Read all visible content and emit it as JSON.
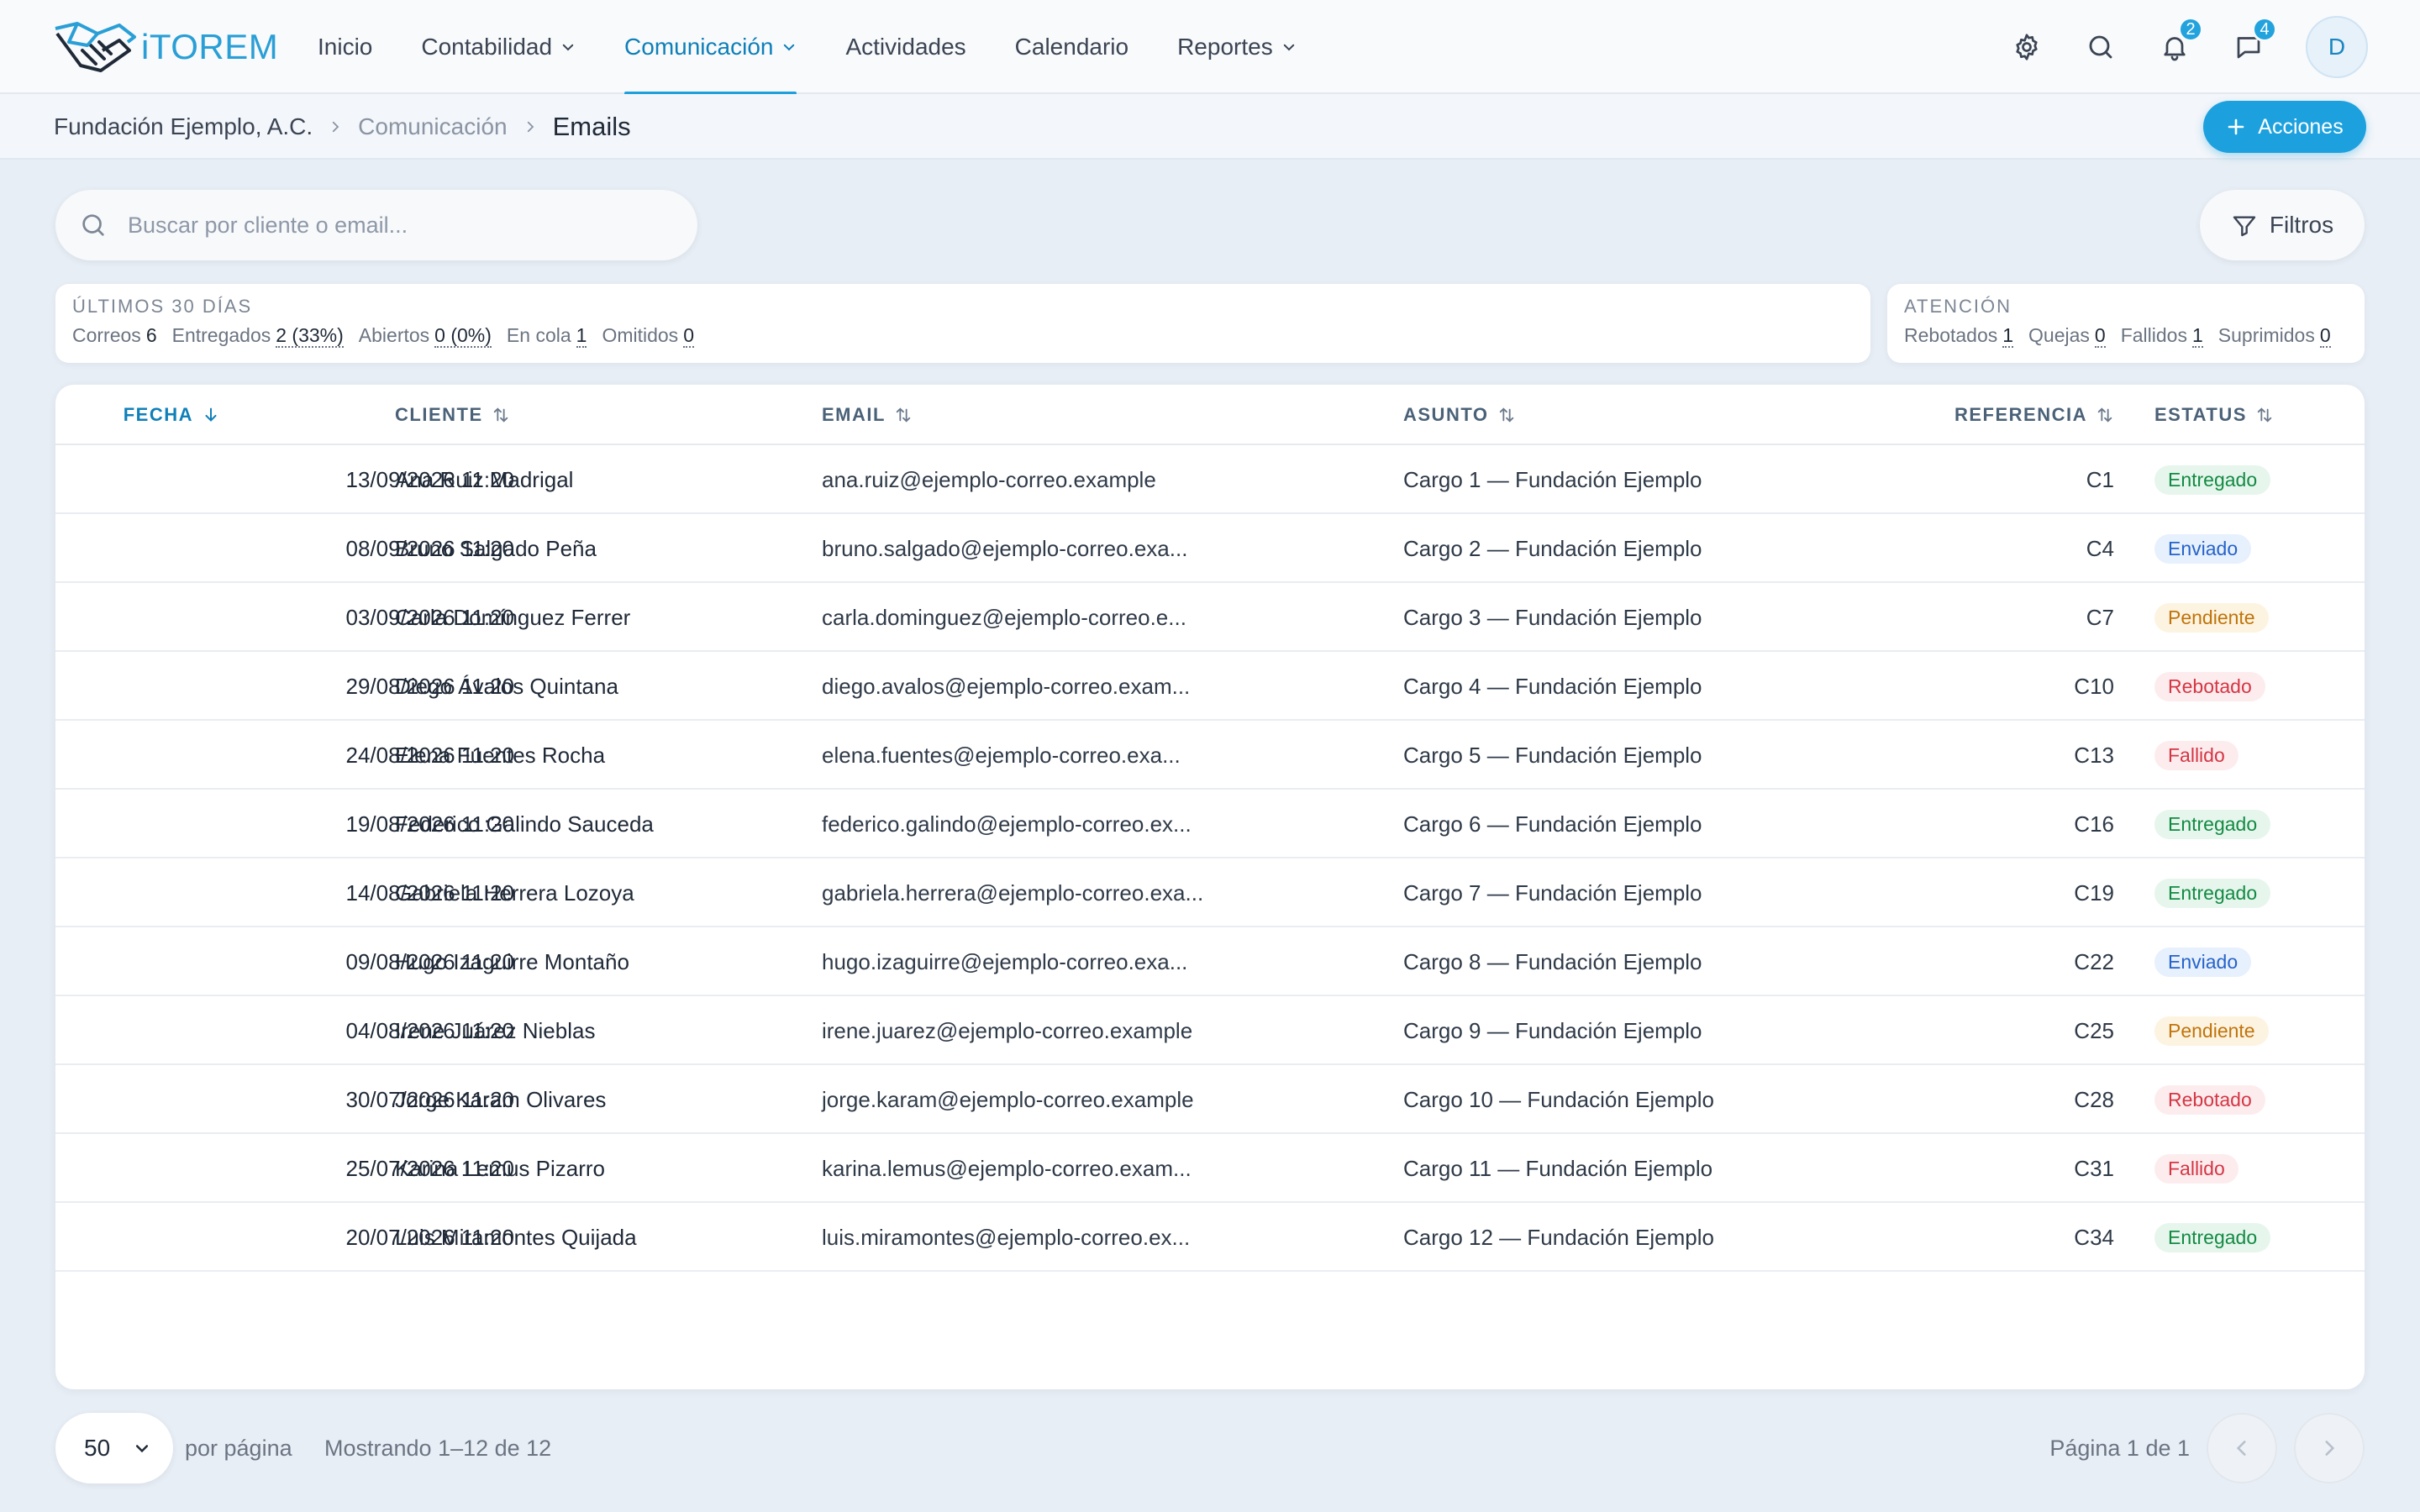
{
  "app": {
    "logo_text": "iTOREM"
  },
  "nav": {
    "items": [
      {
        "label": "Inicio",
        "dropdown": false,
        "active": false
      },
      {
        "label": "Contabilidad",
        "dropdown": true,
        "active": false
      },
      {
        "label": "Comunicación",
        "dropdown": true,
        "active": true
      },
      {
        "label": "Actividades",
        "dropdown": false,
        "active": false
      },
      {
        "label": "Calendario",
        "dropdown": false,
        "active": false
      },
      {
        "label": "Reportes",
        "dropdown": true,
        "active": false
      }
    ],
    "notifications_count": "2",
    "messages_count": "4",
    "avatar_initial": "D"
  },
  "breadcrumb": {
    "organization": "Fundación Ejemplo, A.C.",
    "section": "Comunicación",
    "page": "Emails"
  },
  "actions_label": "Acciones",
  "search": {
    "placeholder": "Buscar por cliente o email...",
    "value": ""
  },
  "filters_label": "Filtros",
  "stats": {
    "period_title": "Últimos 30 días",
    "period": [
      {
        "label": "Correos",
        "value": "6",
        "underline": false
      },
      {
        "label": "Entregados",
        "value": "2 (33%)",
        "underline": true
      },
      {
        "label": "Abiertos",
        "value": "0 (0%)",
        "underline": true
      },
      {
        "label": "En cola",
        "value": "1",
        "underline": true
      },
      {
        "label": "Omitidos",
        "value": "0",
        "underline": true
      }
    ],
    "attention_title": "Atención",
    "attention": [
      {
        "label": "Rebotados",
        "value": "1"
      },
      {
        "label": "Quejas",
        "value": "0"
      },
      {
        "label": "Fallidos",
        "value": "1"
      },
      {
        "label": "Suprimidos",
        "value": "0"
      }
    ]
  },
  "table": {
    "columns": {
      "date": "FECHA",
      "client": "CLIENTE",
      "email": "EMAIL",
      "subject": "ASUNTO",
      "reference": "REFERENCIA",
      "status": "ESTATUS"
    },
    "rows": [
      {
        "date": "13/09/2026 11:20",
        "client": "Ana Ruiz Madrigal",
        "email": "ana.ruiz@ejemplo-correo.example",
        "subject": "Cargo 1 — Fundación Ejemplo",
        "reference": "C1",
        "status": "Entregado",
        "status_kind": "entregado"
      },
      {
        "date": "08/09/2026 11:20",
        "client": "Bruno Salgado Peña",
        "email": "bruno.salgado@ejemplo-correo.exa...",
        "subject": "Cargo 2 — Fundación Ejemplo",
        "reference": "C4",
        "status": "Enviado",
        "status_kind": "enviado"
      },
      {
        "date": "03/09/2026 11:20",
        "client": "Carla Domínguez Ferrer",
        "email": "carla.dominguez@ejemplo-correo.e...",
        "subject": "Cargo 3 — Fundación Ejemplo",
        "reference": "C7",
        "status": "Pendiente",
        "status_kind": "pendiente"
      },
      {
        "date": "29/08/2026 11:20",
        "client": "Diego Ávalos Quintana",
        "email": "diego.avalos@ejemplo-correo.exam...",
        "subject": "Cargo 4 — Fundación Ejemplo",
        "reference": "C10",
        "status": "Rebotado",
        "status_kind": "rebotado"
      },
      {
        "date": "24/08/2026 11:20",
        "client": "Elena Fuentes Rocha",
        "email": "elena.fuentes@ejemplo-correo.exa...",
        "subject": "Cargo 5 — Fundación Ejemplo",
        "reference": "C13",
        "status": "Fallido",
        "status_kind": "fallido"
      },
      {
        "date": "19/08/2026 11:20",
        "client": "Federico Galindo Sauceda",
        "email": "federico.galindo@ejemplo-correo.ex...",
        "subject": "Cargo 6 — Fundación Ejemplo",
        "reference": "C16",
        "status": "Entregado",
        "status_kind": "entregado"
      },
      {
        "date": "14/08/2026 11:20",
        "client": "Gabriela Herrera Lozoya",
        "email": "gabriela.herrera@ejemplo-correo.exa...",
        "subject": "Cargo 7 — Fundación Ejemplo",
        "reference": "C19",
        "status": "Entregado",
        "status_kind": "entregado"
      },
      {
        "date": "09/08/2026 11:20",
        "client": "Hugo Izaguirre Montaño",
        "email": "hugo.izaguirre@ejemplo-correo.exa...",
        "subject": "Cargo 8 — Fundación Ejemplo",
        "reference": "C22",
        "status": "Enviado",
        "status_kind": "enviado"
      },
      {
        "date": "04/08/2026 11:20",
        "client": "Irene Juárez Nieblas",
        "email": "irene.juarez@ejemplo-correo.example",
        "subject": "Cargo 9 — Fundación Ejemplo",
        "reference": "C25",
        "status": "Pendiente",
        "status_kind": "pendiente"
      },
      {
        "date": "30/07/2026 11:20",
        "client": "Jorge Karam Olivares",
        "email": "jorge.karam@ejemplo-correo.example",
        "subject": "Cargo 10 — Fundación Ejemplo",
        "reference": "C28",
        "status": "Rebotado",
        "status_kind": "rebotado"
      },
      {
        "date": "25/07/2026 11:20",
        "client": "Karina Lemus Pizarro",
        "email": "karina.lemus@ejemplo-correo.exam...",
        "subject": "Cargo 11 — Fundación Ejemplo",
        "reference": "C31",
        "status": "Fallido",
        "status_kind": "fallido"
      },
      {
        "date": "20/07/2026 11:20",
        "client": "Luis Miramontes Quijada",
        "email": "luis.miramontes@ejemplo-correo.ex...",
        "subject": "Cargo 12 — Fundación Ejemplo",
        "reference": "C34",
        "status": "Entregado",
        "status_kind": "entregado"
      }
    ]
  },
  "footer": {
    "per_page_value": "50",
    "per_page_label": "por página",
    "showing": "Mostrando 1–12 de 12",
    "page_info": "Página 1 de 1"
  },
  "colors": {
    "accent": "#1da1de",
    "background": "#e8eef5",
    "status_delivered": "#138a43",
    "status_sent": "#2563c9",
    "status_pending": "#c0740a",
    "status_error": "#d43644"
  }
}
